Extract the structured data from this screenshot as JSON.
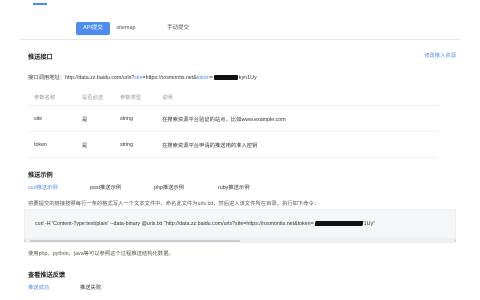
{
  "tabs": [
    {
      "label": "API提交",
      "active": true
    },
    {
      "label": "sitemap",
      "active": false
    },
    {
      "label": "手动提交",
      "active": false
    }
  ],
  "push_interface": {
    "title": "推送接口",
    "right_link": "修改推入资源",
    "endpoint_label": "接口调用地址：",
    "endpoint_url_prefix": "http://data.zz.baidu.com/urls?",
    "endpoint_site_key": "site",
    "endpoint_site_value": "=https://rosmontis.net&",
    "endpoint_token_key": "token",
    "endpoint_token_suffix": "=",
    "endpoint_token_tail": "kyn1Uy"
  },
  "params": {
    "headers": [
      "参数名称",
      "是否必选",
      "参数类型",
      "说明"
    ],
    "rows": [
      {
        "name": "site",
        "required": "是",
        "type": "string",
        "desc": "在搜索资源平台验证的站点，比如www.example.com"
      },
      {
        "name": "token",
        "required": "是",
        "type": "string",
        "desc": "在搜索资源平台申请的推送用的准入密钥"
      }
    ]
  },
  "push_example": {
    "title": "推送示例",
    "tabs": [
      {
        "label": "curl推送示例",
        "active": true
      },
      {
        "label": "post推送示例",
        "active": false
      },
      {
        "label": "php推送示例",
        "active": false
      },
      {
        "label": "ruby推送示例",
        "active": false
      }
    ],
    "description": "将要提交的链接按照每行一条的格式写入一个文本文件中，命名此文件为urls.txt，然后进入该文件所在目录，执行如下命令：",
    "code_prefix": "curl -H 'Content-Type:text/plain' --data-binary @urls.txt \"http://data.zz.baidu.com/urls?site=https://rosmontis.net&token=",
    "code_suffix": "1Uy\"",
    "scroll_left": "‹",
    "scroll_right": "›",
    "usage_note": "使用php、python、java等可以参照这个过程推送结构化数据。"
  },
  "feedback": {
    "title": "查看推送反馈",
    "tabs": [
      {
        "label": "推送成功",
        "active": true
      },
      {
        "label": "推送失败",
        "active": false
      }
    ]
  },
  "colors": {
    "accent": "#4e8df0"
  }
}
